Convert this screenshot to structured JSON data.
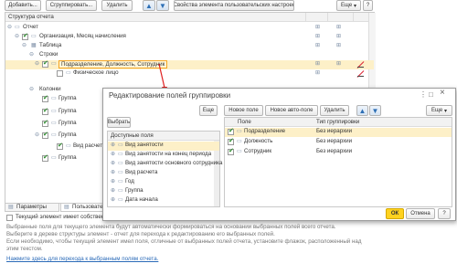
{
  "toolbar": {
    "add": "Добавить...",
    "group": "Сгруппировать...",
    "delete": "Удалить",
    "up": "▲",
    "down": "▼",
    "props": "Свойства элемента пользовательских настроек",
    "more": "Еще",
    "more_caret": "▾",
    "help": "?"
  },
  "tree": {
    "header": "Структура отчета",
    "items": [
      {
        "label": "Отчет"
      },
      {
        "label": "Организация, Месяц начисления"
      },
      {
        "label": "Таблица"
      },
      {
        "label": "Строки"
      },
      {
        "label": "Подразделение, Должность, Сотрудник"
      },
      {
        "label": "Физическое лицо"
      },
      {
        "label": "Колонки"
      },
      {
        "label": "Группа"
      },
      {
        "label": "Группа"
      },
      {
        "label": "Группа"
      },
      {
        "label": "Группа"
      },
      {
        "label": "Вид расчета"
      },
      {
        "label": "Группа"
      }
    ]
  },
  "tabs": {
    "params": "Параметры",
    "user": "Пользовател"
  },
  "bottom": {
    "checkbox": "Текущий элемент имеет собственн",
    "info1": "Выбранные поля для текущего элемента будут автоматически формироваться на основании выбранных полей всего отчета.",
    "info2": "Выберите в дереве структуры элемент - отчет для перехода к редактированию его выбранных полей.",
    "info3": "Если необходимо, чтобы текущий элемент имел поля, отличные от выбранных полей отчета, установите флажок, расположенный над",
    "info4": "этим текстом.",
    "link": "Нажмите здесь для перехода к выбранным полям отчета."
  },
  "dialog": {
    "title": "Редактирование полей группировки",
    "menu_icon": "⋮",
    "maximize_icon": "□",
    "close_icon": "×",
    "left": {
      "more": "Еще",
      "choose": "Выбрать",
      "col_header": "Доступные поля",
      "fields": [
        "Вид занятости",
        "Вид занятости на конец периода",
        "Вид занятости основного сотрудника",
        "Вид расчета",
        "Год",
        "Группа",
        "Дата начала"
      ]
    },
    "right": {
      "new_field": "Новое поле",
      "new_auto": "Новое авто-поле",
      "delete": "Удалить",
      "more": "Еще",
      "col_field": "Поле",
      "col_type": "Тип группировки",
      "rows": [
        {
          "field": "Подразделение",
          "type": "Без иерархии"
        },
        {
          "field": "Должность",
          "type": "Без иерархии"
        },
        {
          "field": "Сотрудник",
          "type": "Без иерархии"
        }
      ]
    },
    "ok": "ОК",
    "cancel": "Отмена",
    "help": "?"
  }
}
